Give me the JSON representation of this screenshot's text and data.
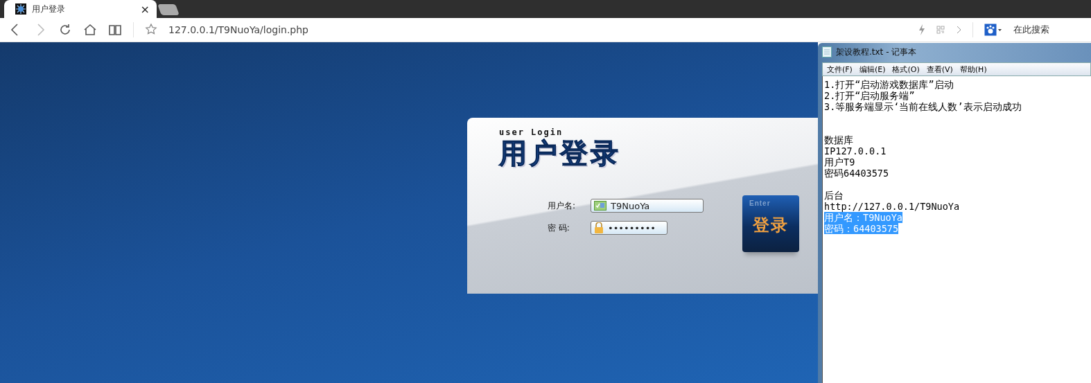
{
  "browser": {
    "tabs": [
      {
        "title": "用户登录",
        "close": "×",
        "selected": true
      }
    ],
    "url": "127.0.0.1/T9NuoYa/login.php",
    "search_placeholder": "在此搜索"
  },
  "login": {
    "subtitle": "user Login",
    "title": "用户登录",
    "fields": [
      {
        "kind": "text",
        "label": "用户名:",
        "value": "T9NuoYa"
      },
      {
        "kind": "password",
        "label": "密 码:",
        "value": "•••••••••"
      }
    ],
    "button": {
      "caption": "Enter",
      "label": "登录"
    }
  },
  "notepad": {
    "title": "架设教程.txt - 记事本",
    "menu": [
      "文件(F)",
      "编辑(E)",
      "格式(O)",
      "查看(V)",
      "帮助(H)"
    ],
    "paragraphs": [
      {
        "lines": [
          {
            "text": "1.打开“启动游戏数据库”启动",
            "selected": false
          },
          {
            "text": "2.打开“启动服务端”",
            "selected": false
          },
          {
            "text": "3.等服务端显示‘当前在线人数’表示启动成功",
            "selected": false
          }
        ]
      },
      {
        "lines": [
          {
            "text": "数据库",
            "selected": false
          },
          {
            "text": "IP127.0.0.1",
            "selected": false
          },
          {
            "text": "用户T9",
            "selected": false
          },
          {
            "text": "密码64403575",
            "selected": false
          }
        ]
      },
      {
        "lines": [
          {
            "text": "后台",
            "selected": false
          },
          {
            "text": "http://127.0.0.1/T9NuoYa",
            "selected": false
          },
          {
            "text": "用户名：T9NuoYa",
            "selected": true
          },
          {
            "text": "密码：64403575",
            "selected": true
          }
        ]
      }
    ]
  }
}
